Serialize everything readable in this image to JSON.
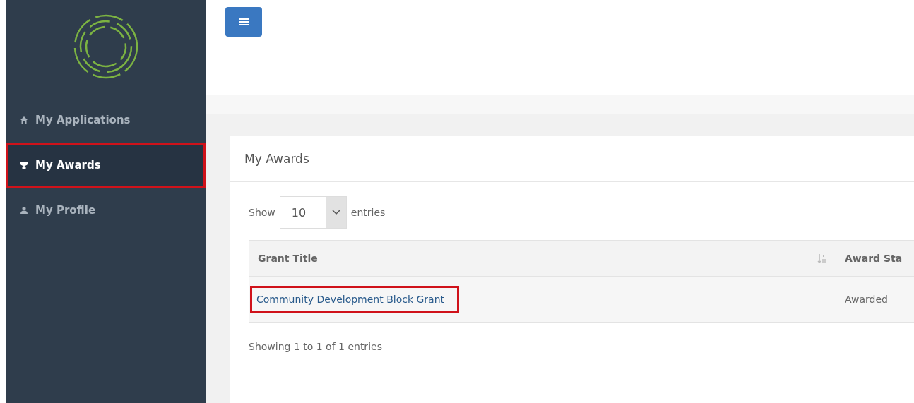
{
  "sidebar": {
    "items": [
      {
        "label": "My Applications",
        "kind": "home",
        "selected": false,
        "highlighted": false
      },
      {
        "label": "My Awards",
        "kind": "trophy",
        "selected": true,
        "highlighted": true
      },
      {
        "label": "My Profile",
        "kind": "user",
        "selected": false,
        "highlighted": false
      }
    ]
  },
  "card": {
    "title": "My Awards",
    "length_menu": {
      "prefix": "Show",
      "value": "10",
      "suffix": "entries"
    },
    "table": {
      "columns": [
        "Grant Title",
        "Award Sta"
      ],
      "rows": [
        {
          "cells": [
            "Community Development Block Grant",
            "Awarded"
          ],
          "highlighted": true
        }
      ]
    },
    "info": "Showing 1 to 1 of 1 entries"
  }
}
